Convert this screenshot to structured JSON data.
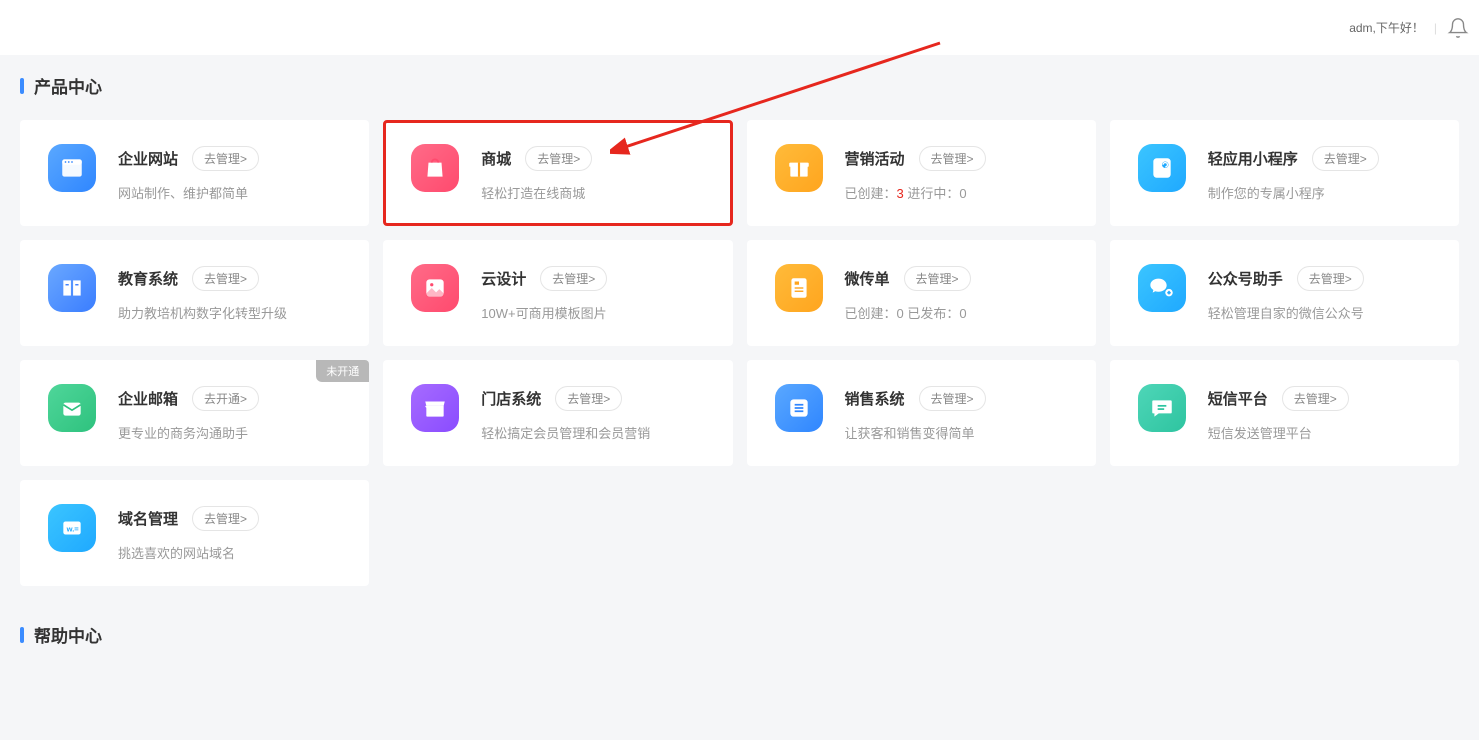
{
  "header": {
    "greeting": "adm,下午好！"
  },
  "sections": {
    "products_title": "产品中心",
    "help_title": "帮助中心"
  },
  "badge_unopened": "未开通",
  "products": [
    {
      "title": "企业网站",
      "button": "去管理>",
      "desc": "网站制作、维护都简单"
    },
    {
      "title": "商城",
      "button": "去管理>",
      "desc": "轻松打造在线商城"
    },
    {
      "title": "营销活动",
      "button": "去管理>",
      "desc_prefix": "已创建：",
      "desc_count": "3",
      "desc_suffix": "   进行中：0"
    },
    {
      "title": "轻应用小程序",
      "button": "去管理>",
      "desc": "制作您的专属小程序"
    },
    {
      "title": "教育系统",
      "button": "去管理>",
      "desc": "助力教培机构数字化转型升级"
    },
    {
      "title": "云设计",
      "button": "去管理>",
      "desc": "10W+可商用模板图片"
    },
    {
      "title": "微传单",
      "button": "去管理>",
      "desc": "已创建：0   已发布：0"
    },
    {
      "title": "公众号助手",
      "button": "去管理>",
      "desc": "轻松管理自家的微信公众号"
    },
    {
      "title": "企业邮箱",
      "button": "去开通>",
      "desc": "更专业的商务沟通助手"
    },
    {
      "title": "门店系统",
      "button": "去管理>",
      "desc": "轻松搞定会员管理和会员营销"
    },
    {
      "title": "销售系统",
      "button": "去管理>",
      "desc": "让获客和销售变得简单"
    },
    {
      "title": "短信平台",
      "button": "去管理>",
      "desc": "短信发送管理平台"
    },
    {
      "title": "域名管理",
      "button": "去管理>",
      "desc": "挑选喜欢的网站域名"
    }
  ]
}
